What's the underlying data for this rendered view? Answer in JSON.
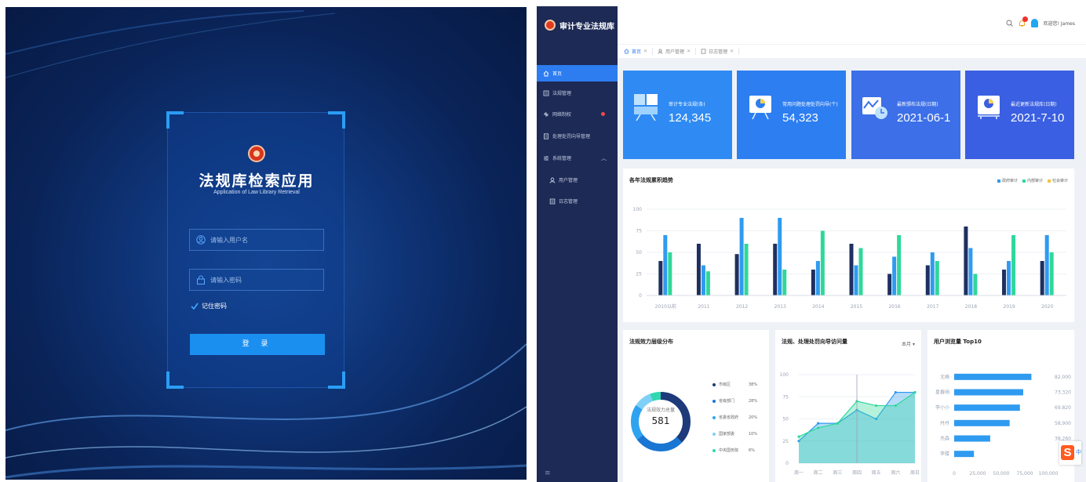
{
  "login": {
    "title": "法规库检索应用",
    "subtitle": "Application of Law Library Retrieval",
    "username_placeholder": "请输入用户名",
    "password_placeholder": "请输入密码",
    "remember_label": "记住密码",
    "login_button": "登 录"
  },
  "dashboard": {
    "brand": "审计专业法规库",
    "header": {
      "welcome": "欢迎您! James"
    },
    "tabs": [
      {
        "label": "首页"
      },
      {
        "label": "用户管理"
      },
      {
        "label": "日志管理"
      }
    ],
    "sidebar": {
      "items": [
        {
          "label": "首页"
        },
        {
          "label": "法规管理"
        },
        {
          "label": "网络制权"
        },
        {
          "label": "处理处罚向导管理"
        },
        {
          "label": "系统管理"
        },
        {
          "label": "用户管理"
        },
        {
          "label": "日志管理"
        }
      ],
      "footer_icon": "menu-icon"
    },
    "stats": [
      {
        "label": "审计专业法规(条)",
        "value": "124,345",
        "color": "#2f8bf3"
      },
      {
        "label": "常用问题处理处罚向导(个)",
        "value": "54,323",
        "color": "#2d7ef1"
      },
      {
        "label": "最新颁布法规(日期)",
        "value": "2021-06-1",
        "color": "#3c6fe8"
      },
      {
        "label": "最近更新法规库(日期)",
        "value": "2021-7-10",
        "color": "#3a5fe2"
      }
    ],
    "colors": {
      "navy": "#1e3060",
      "blue": "#2f9bf0",
      "teal": "#2fd89a",
      "yellow": "#f5c242"
    }
  },
  "chart_data": [
    {
      "type": "bar",
      "title": "各年法规累积趋势",
      "categories": [
        "2010以前",
        "2011",
        "2012",
        "2013",
        "2014",
        "2015",
        "2016",
        "2017",
        "2018",
        "2019",
        "2020"
      ],
      "series": [
        {
          "name": "政府审计",
          "values": [
            40,
            60,
            48,
            60,
            30,
            60,
            25,
            35,
            80,
            30,
            40
          ]
        },
        {
          "name": "内部审计",
          "values": [
            70,
            35,
            90,
            90,
            40,
            35,
            45,
            50,
            55,
            40,
            70
          ]
        },
        {
          "name": "社会审计",
          "values": [
            50,
            28,
            60,
            30,
            75,
            55,
            70,
            40,
            25,
            70,
            50
          ]
        }
      ],
      "ylim": [
        0,
        100
      ],
      "yticks": [
        "0",
        "25",
        "50",
        "75",
        "100"
      ],
      "legend": "top-right"
    },
    {
      "type": "pie",
      "title": "法规效力层级分布",
      "center_label": "法规效力总量",
      "center_value": "581",
      "categories": [
        "市级区",
        "省级部门",
        "省委省政府",
        "国家部委",
        "中央国务院"
      ],
      "percents": [
        "38%",
        "28%",
        "20%",
        "10%",
        "6%"
      ],
      "values": [
        38,
        28,
        20,
        10,
        6
      ],
      "colors": [
        "#1e3a7a",
        "#1976d2",
        "#2fa3f0",
        "#7fd0f7",
        "#2fd8b0"
      ]
    },
    {
      "type": "area",
      "title": "法规、处理处罚向导访问量",
      "dropdown": "本月",
      "categories": [
        "周一",
        "周二",
        "周三",
        "周四",
        "周五",
        "周六",
        "周日"
      ],
      "series": [
        {
          "values": [
            25,
            45,
            45,
            60,
            50,
            80,
            80
          ]
        },
        {
          "values": [
            30,
            40,
            45,
            70,
            65,
            65,
            80
          ]
        }
      ],
      "ylim": [
        0,
        100
      ],
      "yticks": [
        "0",
        "25",
        "50",
        "75",
        "100"
      ]
    },
    {
      "type": "bar",
      "orientation": "horizontal",
      "title": "用户浏览量 Top10",
      "categories": [
        "尤格",
        "夏春明",
        "李小小",
        "丹丹",
        "杰森",
        "李楼"
      ],
      "values": [
        82000,
        73320,
        69820,
        58900,
        38260,
        21000
      ],
      "value_labels": [
        "82,000",
        "73,320",
        "69,820",
        "58,900",
        "38,260",
        "2"
      ],
      "xlim": [
        0,
        100000
      ],
      "xticks": [
        "0",
        "25,000",
        "50,000",
        "75,000",
        "100,000"
      ]
    }
  ]
}
